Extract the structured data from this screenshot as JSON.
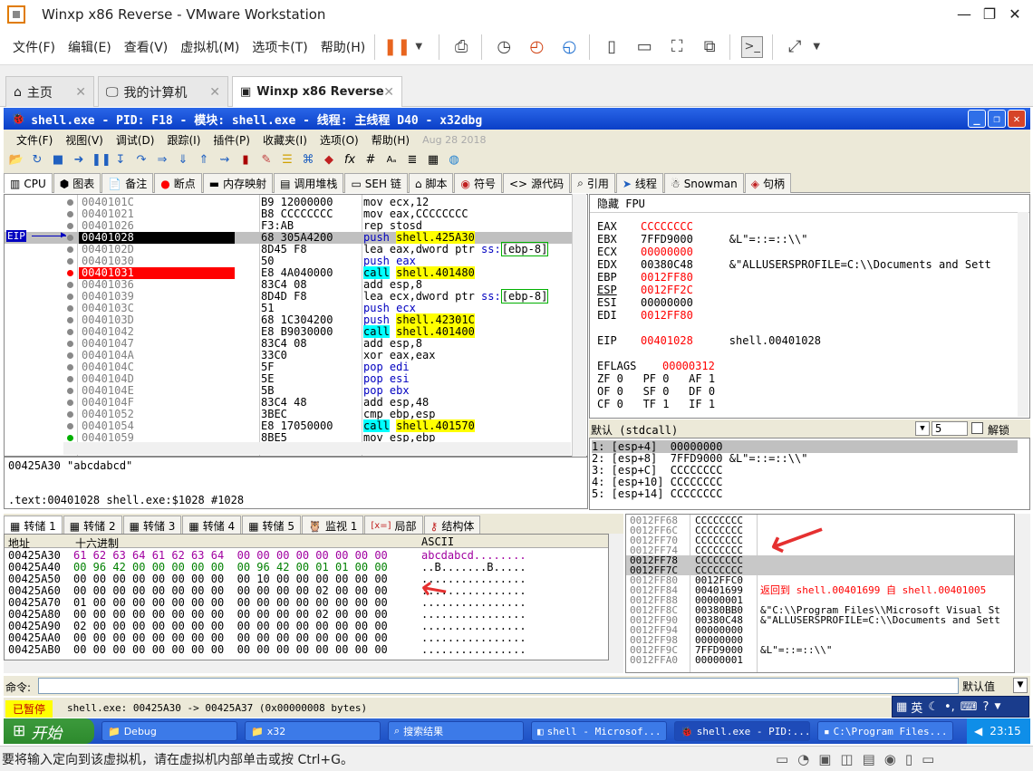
{
  "vm": {
    "title": "Winxp x86 Reverse - VMware Workstation",
    "menu": [
      "文件(F)",
      "编辑(E)",
      "查看(V)",
      "虚拟机(M)",
      "选项卡(T)",
      "帮助(H)"
    ],
    "tabs": [
      "主页",
      "我的计算机",
      "Winxp x86 Reverse"
    ],
    "status": "要将输入定向到该虚拟机，请在虚拟机内部单击或按 Ctrl+G。"
  },
  "dbg": {
    "title": "shell.exe - PID: F18 - 模块: shell.exe - 线程: 主线程 D40 - x32dbg",
    "menu": [
      "文件(F)",
      "视图(V)",
      "调试(D)",
      "跟踪(I)",
      "插件(P)",
      "收藏夹(I)",
      "选项(O)",
      "帮助(H)"
    ],
    "date": "Aug 28 2018",
    "tabs": [
      "CPU",
      "图表",
      "备注",
      "断点",
      "内存映射",
      "调用堆栈",
      "SEH 链",
      "脚本",
      "符号",
      "源代码",
      "引用",
      "线程",
      "Snowman",
      "句柄"
    ],
    "eip_label": "EIP",
    "disasm": [
      {
        "addr": "0040101C",
        "bytes": "B9 12000000",
        "asm": [
          [
            "mov ",
            "n"
          ],
          [
            "ecx,12",
            "n"
          ]
        ]
      },
      {
        "addr": "00401021",
        "bytes": "B8 CCCCCCCC",
        "asm": [
          [
            "mov ",
            "n"
          ],
          [
            "eax,CCCCCCCC",
            "n"
          ]
        ]
      },
      {
        "addr": "00401026",
        "bytes": "F3:AB",
        "asm": [
          [
            "rep stosd",
            "n"
          ]
        ]
      },
      {
        "addr": "00401028",
        "bytes": "68 305A4200",
        "asm": [
          [
            "push ",
            "push"
          ],
          [
            "shell.425A30",
            "y"
          ]
        ],
        "eip": true
      },
      {
        "addr": "0040102D",
        "bytes": "8D45 F8",
        "asm": [
          [
            "lea eax,dword ptr ",
            "n"
          ],
          [
            "ss:",
            "b"
          ],
          [
            "[ebp-8]",
            "g"
          ]
        ]
      },
      {
        "addr": "00401030",
        "bytes": "50",
        "asm": [
          [
            "push ",
            "push"
          ],
          [
            "eax",
            "b"
          ]
        ]
      },
      {
        "addr": "00401031",
        "bytes": "E8 4A040000",
        "asm": [
          [
            "call",
            "call"
          ],
          [
            " ",
            "n"
          ],
          [
            "shell.401480",
            "y"
          ]
        ],
        "bp": true
      },
      {
        "addr": "00401036",
        "bytes": "83C4 08",
        "asm": [
          [
            "add esp,8",
            "n"
          ]
        ]
      },
      {
        "addr": "00401039",
        "bytes": "8D4D F8",
        "asm": [
          [
            "lea ecx,dword ptr ",
            "n"
          ],
          [
            "ss:",
            "b"
          ],
          [
            "[ebp-8]",
            "g"
          ]
        ]
      },
      {
        "addr": "0040103C",
        "bytes": "51",
        "asm": [
          [
            "push ",
            "push"
          ],
          [
            "ecx",
            "b"
          ]
        ]
      },
      {
        "addr": "0040103D",
        "bytes": "68 1C304200",
        "asm": [
          [
            "push ",
            "push"
          ],
          [
            "shell.42301C",
            "y"
          ]
        ]
      },
      {
        "addr": "00401042",
        "bytes": "E8 B9030000",
        "asm": [
          [
            "call",
            "call"
          ],
          [
            " ",
            "n"
          ],
          [
            "shell.401400",
            "y"
          ]
        ]
      },
      {
        "addr": "00401047",
        "bytes": "83C4 08",
        "asm": [
          [
            "add esp,8",
            "n"
          ]
        ]
      },
      {
        "addr": "0040104A",
        "bytes": "33C0",
        "asm": [
          [
            "xor eax,eax",
            "n"
          ]
        ]
      },
      {
        "addr": "0040104C",
        "bytes": "5F",
        "asm": [
          [
            "pop ",
            "push"
          ],
          [
            "edi",
            "b"
          ]
        ]
      },
      {
        "addr": "0040104D",
        "bytes": "5E",
        "asm": [
          [
            "pop ",
            "push"
          ],
          [
            "esi",
            "b"
          ]
        ]
      },
      {
        "addr": "0040104E",
        "bytes": "5B",
        "asm": [
          [
            "pop ",
            "push"
          ],
          [
            "ebx",
            "b"
          ]
        ]
      },
      {
        "addr": "0040104F",
        "bytes": "83C4 48",
        "asm": [
          [
            "add esp,48",
            "n"
          ]
        ]
      },
      {
        "addr": "00401052",
        "bytes": "3BEC",
        "asm": [
          [
            "cmp ebp,esp",
            "n"
          ]
        ]
      },
      {
        "addr": "00401054",
        "bytes": "E8 17050000",
        "asm": [
          [
            "call",
            "call"
          ],
          [
            " ",
            "n"
          ],
          [
            "shell.401570",
            "y"
          ]
        ]
      },
      {
        "addr": "00401059",
        "bytes": "8BE5",
        "asm": [
          [
            "mov esp,ebp",
            "n"
          ]
        ]
      }
    ],
    "info_line1": "00425A30 \"abcdabcd\"",
    "info_line2": ".text:00401028 shell.exe:$1028 #1028",
    "regs_header": "隐藏 FPU",
    "regs": [
      {
        "n": "EAX",
        "v": "CCCCCCCC",
        "c": ""
      },
      {
        "n": "EBX",
        "v": "7FFD9000",
        "c": "&L\"=::=::\\\\\""
      },
      {
        "n": "ECX",
        "v": "00000000",
        "c": ""
      },
      {
        "n": "EDX",
        "v": "00380C48",
        "c": "&\"ALLUSERSPROFILE=C:\\\\Documents and Sett"
      },
      {
        "n": "EBP",
        "v": "0012FF80",
        "c": ""
      },
      {
        "n": "ESP",
        "v": "0012FF2C",
        "c": ""
      },
      {
        "n": "ESI",
        "v": "00000000",
        "c": ""
      },
      {
        "n": "EDI",
        "v": "0012FF80",
        "c": ""
      }
    ],
    "eip_reg": {
      "n": "EIP",
      "v": "00401028",
      "c": "shell.00401028"
    },
    "eflags": {
      "n": "EFLAGS",
      "v": "00000312"
    },
    "flags": [
      "ZF 0   PF 0   AF 1",
      "OF 0   SF 0   DF 0",
      "CF 0   TF 1   IF 1"
    ],
    "callconv": "默认 (stdcall)",
    "argcount": "5",
    "unlock": "解锁",
    "stackargs": [
      "1: [esp+4]  00000000",
      "2: [esp+8]  7FFD9000 &L\"=::=::\\\\\"",
      "3: [esp+C]  CCCCCCCC",
      "4: [esp+10] CCCCCCCC",
      "5: [esp+14] CCCCCCCC"
    ],
    "dump_tabs": [
      "转储 1",
      "转储 2",
      "转储 3",
      "转储 4",
      "转储 5",
      "监视 1",
      "局部",
      "结构体"
    ],
    "dump_cols": [
      "地址",
      "十六进制",
      "ASCII"
    ],
    "dump": [
      {
        "a": "00425A30",
        "h": "61 62 63 64 61 62 63 64  00 00 00 00 00 00 00 00",
        "s": "abcdabcd........"
      },
      {
        "a": "00425A40",
        "h": "00 96 42 00 00 00 00 00  00 96 42 00 01 01 00 00",
        "s": "..B.......B....."
      },
      {
        "a": "00425A50",
        "h": "00 00 00 00 00 00 00 00  00 10 00 00 00 00 00 00",
        "s": "................"
      },
      {
        "a": "00425A60",
        "h": "00 00 00 00 00 00 00 00  00 00 00 00 02 00 00 00",
        "s": "................"
      },
      {
        "a": "00425A70",
        "h": "01 00 00 00 00 00 00 00  00 00 00 00 00 00 00 00",
        "s": "................"
      },
      {
        "a": "00425A80",
        "h": "00 00 00 00 00 00 00 00  00 00 00 00 02 00 00 00",
        "s": "................"
      },
      {
        "a": "00425A90",
        "h": "02 00 00 00 00 00 00 00  00 00 00 00 00 00 00 00",
        "s": "................"
      },
      {
        "a": "00425AA0",
        "h": "00 00 00 00 00 00 00 00  00 00 00 00 00 00 00 00",
        "s": "................"
      },
      {
        "a": "00425AB0",
        "h": "00 00 00 00 00 00 00 00  00 00 00 00 00 00 00 00",
        "s": "................"
      }
    ],
    "stack": [
      {
        "a": "0012FF68",
        "v": "CCCCCCCC",
        "c": ""
      },
      {
        "a": "0012FF6C",
        "v": "CCCCCCCC",
        "c": ""
      },
      {
        "a": "0012FF70",
        "v": "CCCCCCCC",
        "c": ""
      },
      {
        "a": "0012FF74",
        "v": "CCCCCCCC",
        "c": ""
      },
      {
        "a": "0012FF78",
        "v": "CCCCCCCC",
        "c": "",
        "hl": true
      },
      {
        "a": "0012FF7C",
        "v": "CCCCCCCC",
        "c": "",
        "hl": true
      },
      {
        "a": "0012FF80",
        "v": "0012FFC0",
        "c": ""
      },
      {
        "a": "0012FF84",
        "v": "00401699",
        "c": "返回到 shell.00401699 自 shell.00401005",
        "red": true
      },
      {
        "a": "0012FF88",
        "v": "00000001",
        "c": ""
      },
      {
        "a": "0012FF8C",
        "v": "00380BB0",
        "c": "&\"C:\\\\Program Files\\\\Microsoft Visual St"
      },
      {
        "a": "0012FF90",
        "v": "00380C48",
        "c": "&\"ALLUSERSPROFILE=C:\\\\Documents and Sett"
      },
      {
        "a": "0012FF94",
        "v": "00000000",
        "c": ""
      },
      {
        "a": "0012FF98",
        "v": "00000000",
        "c": ""
      },
      {
        "a": "0012FF9C",
        "v": "7FFD9000",
        "c": "&L\"=::=::\\\\\""
      },
      {
        "a": "0012FFA0",
        "v": "00000001",
        "c": ""
      }
    ],
    "cmd_label": "命令:",
    "cmd_default": "默认值",
    "status_paused": "已暂停",
    "status_text": "shell.exe: 00425A30 -> 00425A37 (0x00000008 bytes)"
  },
  "taskbar": {
    "start": "开始",
    "items": [
      "Debug",
      "x32",
      "搜索结果",
      "shell - Microsof...",
      "shell.exe - PID:...",
      "C:\\Program Files..."
    ],
    "time": "23:15",
    "ime": "英"
  }
}
